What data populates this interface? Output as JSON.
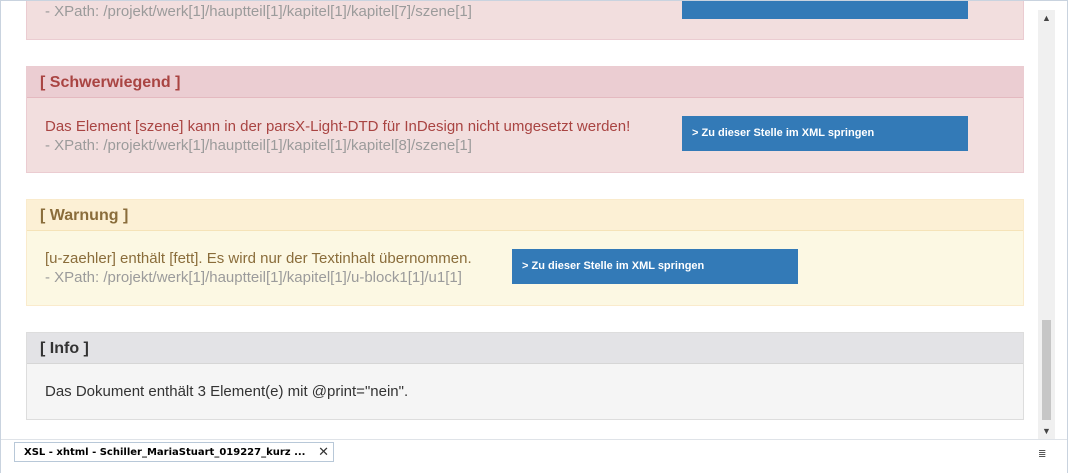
{
  "panels": {
    "top_partial": {
      "xpath": "- XPath: /projekt/werk[1]/hauptteil[1]/kapitel[1]/kapitel[7]/szene[1]"
    },
    "error": {
      "heading": "[ Schwerwiegend ]",
      "message": "Das Element [szene] kann in der parsX-Light-DTD für InDesign nicht umgesetzt werden!",
      "xpath": "- XPath: /projekt/werk[1]/hauptteil[1]/kapitel[1]/kapitel[8]/szene[1]",
      "button": "> Zu dieser Stelle im XML springen"
    },
    "warning": {
      "heading": "[ Warnung ]",
      "message": "[u-zaehler] enthält [fett]. Es wird nur der Textinhalt übernommen.",
      "xpath": "- XPath: /projekt/werk[1]/hauptteil[1]/kapitel[1]/u-block1[1]/u1[1]",
      "button": "> Zu dieser Stelle im XML springen"
    },
    "info": {
      "heading": "[ Info ]",
      "message": "Das Dokument enthält 3 Element(e) mit @print=\"nein\"."
    }
  },
  "tab": {
    "label": "XSL - xhtml - Schiller_MariaStuart_019227_kurz ...",
    "close": "✕"
  },
  "icons": {
    "scroll_up": "▲",
    "scroll_down": "▼",
    "doc_menu": "≣"
  }
}
